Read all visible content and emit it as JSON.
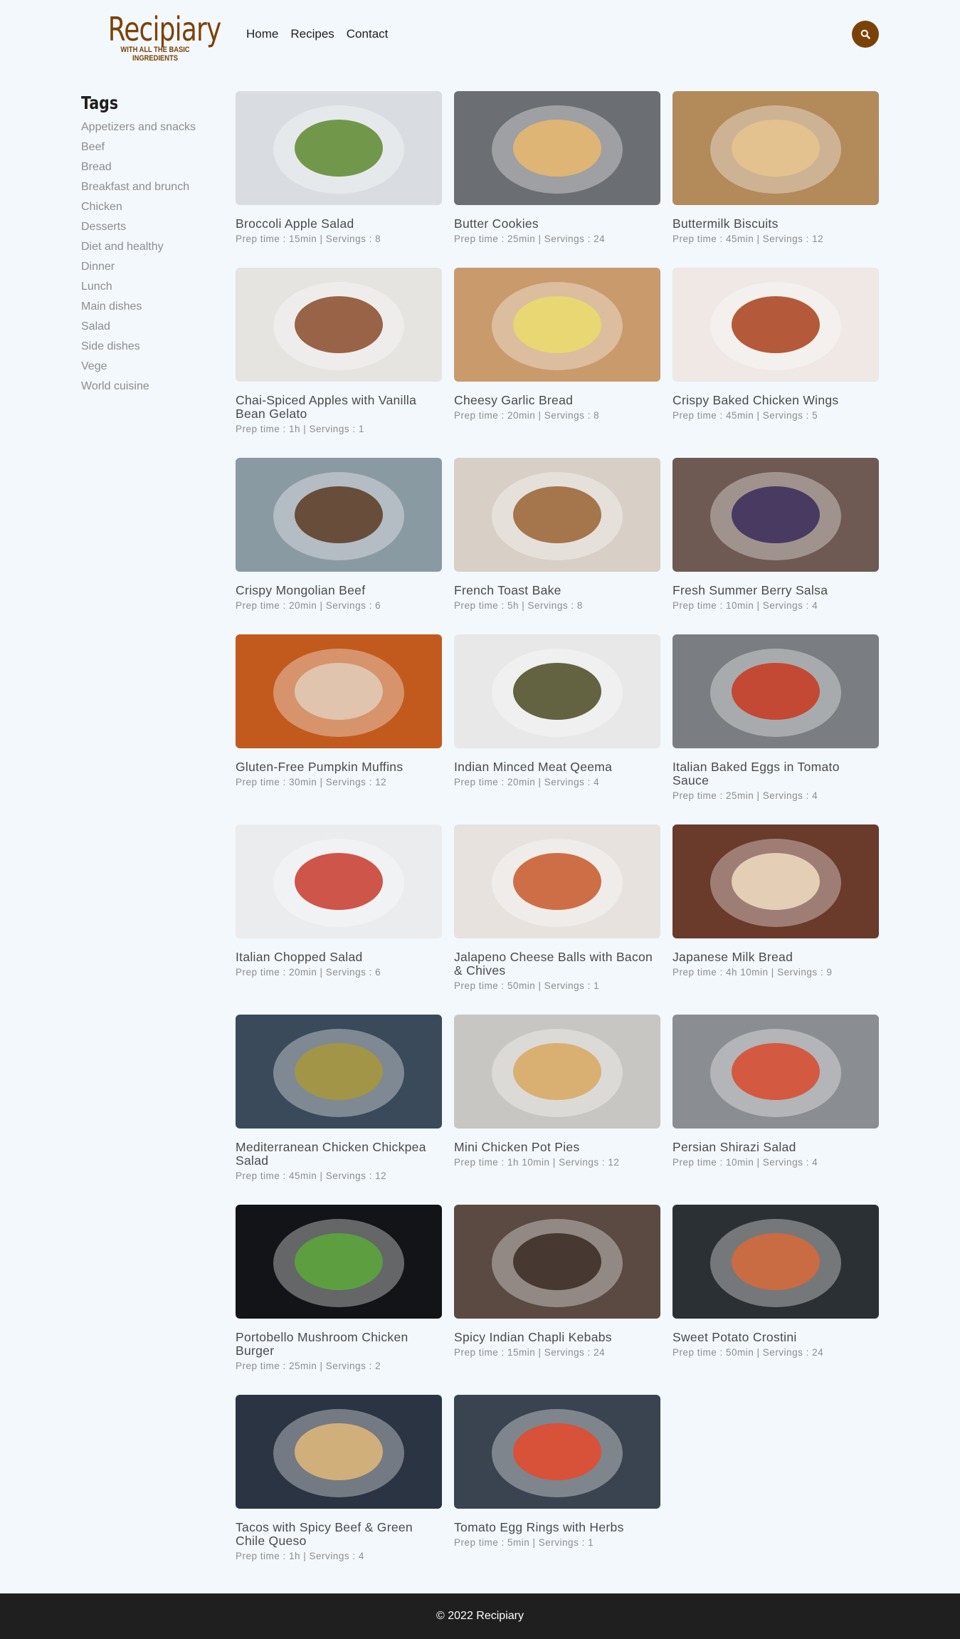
{
  "brand": {
    "name": "Recipiary",
    "tagline": "WITH ALL THE BASIC INGREDIENTS",
    "color": "#7b4208"
  },
  "nav": {
    "items": [
      {
        "label": "Home"
      },
      {
        "label": "Recipes"
      },
      {
        "label": "Contact"
      }
    ],
    "search_icon": "search-icon"
  },
  "sidebar": {
    "title": "Tags",
    "tags": [
      {
        "label": "Appetizers and snacks"
      },
      {
        "label": "Beef"
      },
      {
        "label": "Bread"
      },
      {
        "label": "Breakfast and brunch"
      },
      {
        "label": "Chicken"
      },
      {
        "label": "Desserts"
      },
      {
        "label": "Diet and healthy"
      },
      {
        "label": "Dinner"
      },
      {
        "label": "Lunch"
      },
      {
        "label": "Main dishes"
      },
      {
        "label": "Salad"
      },
      {
        "label": "Side dishes"
      },
      {
        "label": "Vege"
      },
      {
        "label": "World cuisine"
      }
    ]
  },
  "recipes": [
    {
      "title": "Broccoli Apple Salad",
      "meta": "Prep time : 15min | Servings : 8",
      "bg": "#d9dde2",
      "accent": "#5c8a2e"
    },
    {
      "title": "Butter Cookies",
      "meta": "Prep time : 25min | Servings : 24",
      "bg": "#6b6e72",
      "accent": "#e9b86c"
    },
    {
      "title": "Buttermilk Biscuits",
      "meta": "Prep time : 45min | Servings : 12",
      "bg": "#b38a5a",
      "accent": "#e6c48e"
    },
    {
      "title": "Chai-Spiced Apples with Vanilla Bean Gelato",
      "meta": "Prep time : 1h | Servings : 1",
      "bg": "#e6e4e0",
      "accent": "#8a4a2a"
    },
    {
      "title": "Cheesy Garlic Bread",
      "meta": "Prep time : 20min | Servings : 8",
      "bg": "#c99a6b",
      "accent": "#eadc6a"
    },
    {
      "title": "Crispy Baked Chicken Wings",
      "meta": "Prep time : 45min | Servings : 5",
      "bg": "#efe8e4",
      "accent": "#a8401a"
    },
    {
      "title": "Crispy Mongolian Beef",
      "meta": "Prep time : 20min | Servings : 6",
      "bg": "#8a9aa3",
      "accent": "#5a3a22"
    },
    {
      "title": "French Toast Bake",
      "meta": "Prep time : 5h | Servings : 8",
      "bg": "#d8cfc6",
      "accent": "#9a6232"
    },
    {
      "title": "Fresh Summer Berry Salsa",
      "meta": "Prep time : 10min | Servings : 4",
      "bg": "#6e5a52",
      "accent": "#3a2a5a"
    },
    {
      "title": "Gluten-Free Pumpkin Muffins",
      "meta": "Prep time : 30min | Servings : 12",
      "bg": "#c25a1e",
      "accent": "#e2cdb8"
    },
    {
      "title": "Indian Minced Meat Qeema",
      "meta": "Prep time : 20min | Servings : 4",
      "bg": "#e8e8e8",
      "accent": "#4a4a22"
    },
    {
      "title": "Italian Baked Eggs in Tomato Sauce",
      "meta": "Prep time : 25min | Servings : 4",
      "bg": "#7a7e82",
      "accent": "#c8371e"
    },
    {
      "title": "Italian Chopped Salad",
      "meta": "Prep time : 20min | Servings : 6",
      "bg": "#eaecee",
      "accent": "#c83a2a"
    },
    {
      "title": "Jalapeno Cheese Balls with Bacon & Chives",
      "meta": "Prep time : 50min | Servings : 1",
      "bg": "#e8e2de",
      "accent": "#c8582a"
    },
    {
      "title": "Japanese Milk Bread",
      "meta": "Prep time : 4h 10min | Servings : 9",
      "bg": "#6a3a2a",
      "accent": "#f0dcc2"
    },
    {
      "title": "Mediterranean Chicken Chickpea Salad",
      "meta": "Prep time : 45min | Servings : 12",
      "bg": "#3a4a5a",
      "accent": "#a8983a"
    },
    {
      "title": "Mini Chicken Pot Pies",
      "meta": "Prep time : 1h 10min | Servings : 12",
      "bg": "#c8c6c2",
      "accent": "#d8a860"
    },
    {
      "title": "Persian Shirazi Salad",
      "meta": "Prep time : 10min | Servings : 4",
      "bg": "#8a8e92",
      "accent": "#d84a2a"
    },
    {
      "title": "Portobello Mushroom Chicken Burger",
      "meta": "Prep time : 25min | Servings : 2",
      "bg": "#121418",
      "accent": "#5aa83a"
    },
    {
      "title": "Spicy Indian Chapli Kebabs",
      "meta": "Prep time : 15min | Servings : 24",
      "bg": "#5a4a42",
      "accent": "#3a2a22"
    },
    {
      "title": "Sweet Potato Crostini",
      "meta": "Prep time : 50min | Servings : 24",
      "bg": "#2a3034",
      "accent": "#d8683a"
    },
    {
      "title": "Tacos with Spicy Beef & Green Chile Queso",
      "meta": "Prep time : 1h | Servings : 4",
      "bg": "#2a3442",
      "accent": "#e2b878"
    },
    {
      "title": "Tomato Egg Rings with Herbs",
      "meta": "Prep time : 5min | Servings : 1",
      "bg": "#3a4450",
      "accent": "#e8482a"
    }
  ],
  "footer": {
    "text": "© 2022 Recipiary"
  }
}
